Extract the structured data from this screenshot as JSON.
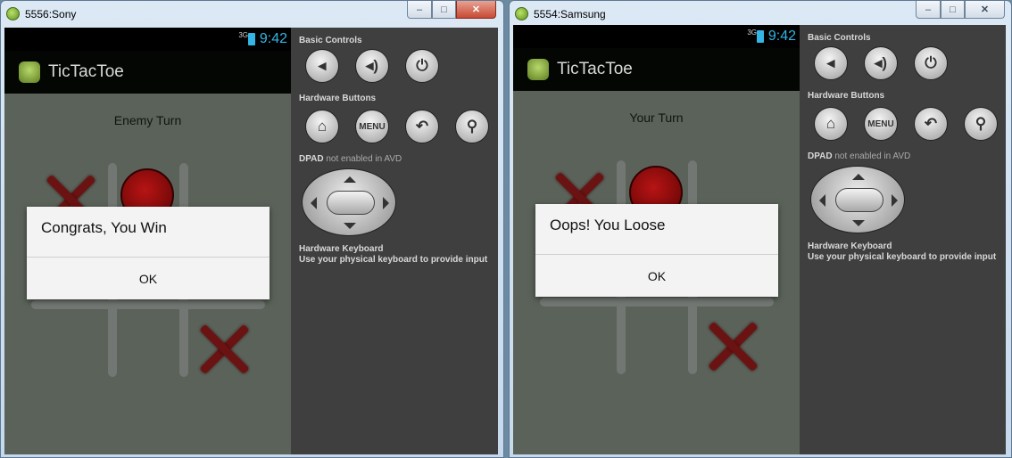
{
  "windows": [
    {
      "title": "5556:Sony",
      "status_time": "9:42",
      "status_signal": "3G",
      "app_title": "TicTacToe",
      "turn_label": "Enemy Turn",
      "dialog": {
        "message": "Congrats, You Win",
        "ok_label": "OK"
      },
      "controls": {
        "basic_controls": "Basic Controls",
        "hardware_buttons": "Hardware Buttons",
        "dpad_label": "DPAD",
        "dpad_note": "not enabled in AVD",
        "keyboard_title": "Hardware Keyboard",
        "keyboard_note": "Use your physical keyboard to provide input",
        "menu_label": "MENU"
      }
    },
    {
      "title": "5554:Samsung",
      "status_time": "9:42",
      "status_signal": "3G",
      "app_title": "TicTacToe",
      "turn_label": "Your Turn",
      "dialog": {
        "message": "Oops! You Loose",
        "ok_label": "OK"
      },
      "controls": {
        "basic_controls": "Basic Controls",
        "hardware_buttons": "Hardware Buttons",
        "dpad_label": "DPAD",
        "dpad_note": "not enabled in AVD",
        "keyboard_title": "Hardware Keyboard",
        "keyboard_note": "Use your physical keyboard to provide input",
        "menu_label": "MENU"
      }
    }
  ],
  "icons": [
    "emulator-icon",
    "signal-icon",
    "battery-icon",
    "android-app-icon",
    "volume-down-icon",
    "volume-up-icon",
    "power-icon",
    "home-icon",
    "back-icon",
    "search-icon"
  ],
  "colors": {
    "status_accent": "#33b5e5",
    "x_mark": "#6b1212",
    "o_mark": "#b71414",
    "close_button": "#c74a32"
  }
}
